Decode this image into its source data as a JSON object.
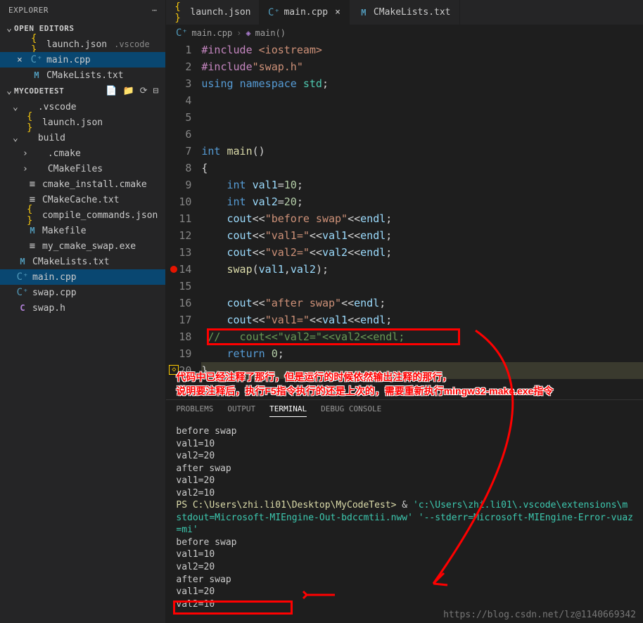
{
  "sidebar": {
    "title": "EXPLORER",
    "open_editors_label": "OPEN EDITORS",
    "open_editors": [
      {
        "icon": "json",
        "name": "launch.json",
        "suffix": ".vscode",
        "close": false
      },
      {
        "icon": "cpp",
        "name": "main.cpp",
        "close": true,
        "active": true
      },
      {
        "icon": "m",
        "name": "CMakeLists.txt",
        "close": false
      }
    ],
    "project_label": "MYCODETEST",
    "tree": [
      {
        "d": 1,
        "chev": "down",
        "icon": "folder",
        "name": ".vscode"
      },
      {
        "d": 2,
        "icon": "json",
        "name": "launch.json"
      },
      {
        "d": 1,
        "chev": "down",
        "icon": "folder",
        "name": "build"
      },
      {
        "d": 2,
        "chev": "right",
        "icon": "folder",
        "name": ".cmake"
      },
      {
        "d": 2,
        "chev": "right",
        "icon": "folder",
        "name": "CMakeFiles"
      },
      {
        "d": 2,
        "icon": "file",
        "name": "cmake_install.cmake"
      },
      {
        "d": 2,
        "icon": "file",
        "name": "CMakeCache.txt"
      },
      {
        "d": 2,
        "icon": "json",
        "name": "compile_commands.json"
      },
      {
        "d": 2,
        "icon": "m",
        "name": "Makefile"
      },
      {
        "d": 2,
        "icon": "file",
        "name": "my_cmake_swap.exe"
      },
      {
        "d": 1,
        "icon": "m",
        "name": "CMakeLists.txt"
      },
      {
        "d": 1,
        "icon": "cpp",
        "name": "main.cpp",
        "active": true
      },
      {
        "d": 1,
        "icon": "cpp",
        "name": "swap.cpp"
      },
      {
        "d": 1,
        "icon": "c",
        "name": "swap.h"
      }
    ]
  },
  "tabs": [
    {
      "icon": "json",
      "label": "launch.json"
    },
    {
      "icon": "cpp",
      "label": "main.cpp",
      "active": true,
      "close": true
    },
    {
      "icon": "m",
      "label": "CMakeLists.txt"
    }
  ],
  "breadcrumb": {
    "file_icon": "cpp",
    "file": "main.cpp",
    "sym_icon": "cube",
    "symbol": "main()"
  },
  "code": {
    "lines": [
      {
        "n": 1,
        "html": "<span class='pp'>#include</span> <span class='s'>&lt;iostream&gt;</span>"
      },
      {
        "n": 2,
        "html": "<span class='pp'>#include</span><span class='s'>\"swap.h\"</span>"
      },
      {
        "n": 3,
        "html": "<span class='k'>using</span> <span class='k'>namespace</span> <span class='t'>std</span><span class='p'>;</span>"
      },
      {
        "n": 4,
        "html": ""
      },
      {
        "n": 5,
        "html": ""
      },
      {
        "n": 6,
        "html": ""
      },
      {
        "n": 7,
        "html": "<span class='k'>int</span> <span class='f'>main</span><span class='p'>()</span>"
      },
      {
        "n": 8,
        "html": "<span class='p'>{</span>"
      },
      {
        "n": 9,
        "html": "    <span class='k'>int</span> <span class='v'>val1</span><span class='p'>=</span><span class='n'>10</span><span class='p'>;</span>"
      },
      {
        "n": 10,
        "html": "    <span class='k'>int</span> <span class='v'>val2</span><span class='p'>=</span><span class='n'>20</span><span class='p'>;</span>"
      },
      {
        "n": 11,
        "html": "    <span class='v'>cout</span><span class='p'>&lt;&lt;</span><span class='s'>\"before swap\"</span><span class='p'>&lt;&lt;</span><span class='v'>endl</span><span class='p'>;</span>"
      },
      {
        "n": 12,
        "html": "    <span class='v'>cout</span><span class='p'>&lt;&lt;</span><span class='s'>\"val1=\"</span><span class='p'>&lt;&lt;</span><span class='v'>val1</span><span class='p'>&lt;&lt;</span><span class='v'>endl</span><span class='p'>;</span>"
      },
      {
        "n": 13,
        "html": "    <span class='v'>cout</span><span class='p'>&lt;&lt;</span><span class='s'>\"val2=\"</span><span class='p'>&lt;&lt;</span><span class='v'>val2</span><span class='p'>&lt;&lt;</span><span class='v'>endl</span><span class='p'>;</span>"
      },
      {
        "n": 14,
        "html": "    <span class='f'>swap</span><span class='p'>(</span><span class='v'>val1</span><span class='p'>,</span><span class='v'>val2</span><span class='p'>);</span>",
        "bp": true
      },
      {
        "n": 15,
        "html": ""
      },
      {
        "n": 16,
        "html": "    <span class='v'>cout</span><span class='p'>&lt;&lt;</span><span class='s'>\"after swap\"</span><span class='p'>&lt;&lt;</span><span class='v'>endl</span><span class='p'>;</span>"
      },
      {
        "n": 17,
        "html": "    <span class='v'>cout</span><span class='p'>&lt;&lt;</span><span class='s'>\"val1=\"</span><span class='p'>&lt;&lt;</span><span class='v'>val1</span><span class='p'>&lt;&lt;</span><span class='v'>endl</span><span class='p'>;</span>"
      },
      {
        "n": 18,
        "html": " <span class='c'>//   cout&lt;&lt;\"val2=\"&lt;&lt;val2&lt;&lt;endl;</span>"
      },
      {
        "n": 19,
        "html": "    <span class='k'>return</span> <span class='n'>0</span><span class='p'>;</span>"
      },
      {
        "n": 20,
        "html": "<span class='p'>}</span>",
        "warn": true,
        "hl": true
      }
    ]
  },
  "annotation": {
    "line1": "代码中已经注释了那行，但是运行的时候依然输出注释的那行，",
    "line2": "说明要注释后，执行F5指令执行的还是上次的，需要重新执行mingw32-make.exe指令"
  },
  "panel": {
    "tabs": [
      "PROBLEMS",
      "OUTPUT",
      "TERMINAL",
      "DEBUG CONSOLE"
    ],
    "active_tab": "TERMINAL",
    "lines": [
      {
        "t": "before swap"
      },
      {
        "t": "val1=10"
      },
      {
        "t": "val2=20"
      },
      {
        "t": "after swap"
      },
      {
        "t": "val1=20"
      },
      {
        "t": "val2=10"
      },
      {
        "html": "<span class='term-yellow'>PS C:\\Users\\zhi.li01\\Desktop\\MyCodeTest&gt;</span> &amp; <span class='term-cyan'>'c:\\Users\\zhi.li01\\.vscode\\extensions\\m</span>"
      },
      {
        "html": "<span class='term-cyan'>stdout=Microsoft-MIEngine-Out-bdccmtii.nww' '--stderr=Microsoft-MIEngine-Error-vuaz</span>"
      },
      {
        "html": "<span class='term-cyan'>=mi'</span>"
      },
      {
        "t": "before swap"
      },
      {
        "t": "val1=10"
      },
      {
        "t": "val2=20"
      },
      {
        "t": "after swap"
      },
      {
        "t": "val1=20"
      },
      {
        "t": "val2=10"
      }
    ]
  },
  "watermark": "https://blog.csdn.net/lz@1140669342"
}
